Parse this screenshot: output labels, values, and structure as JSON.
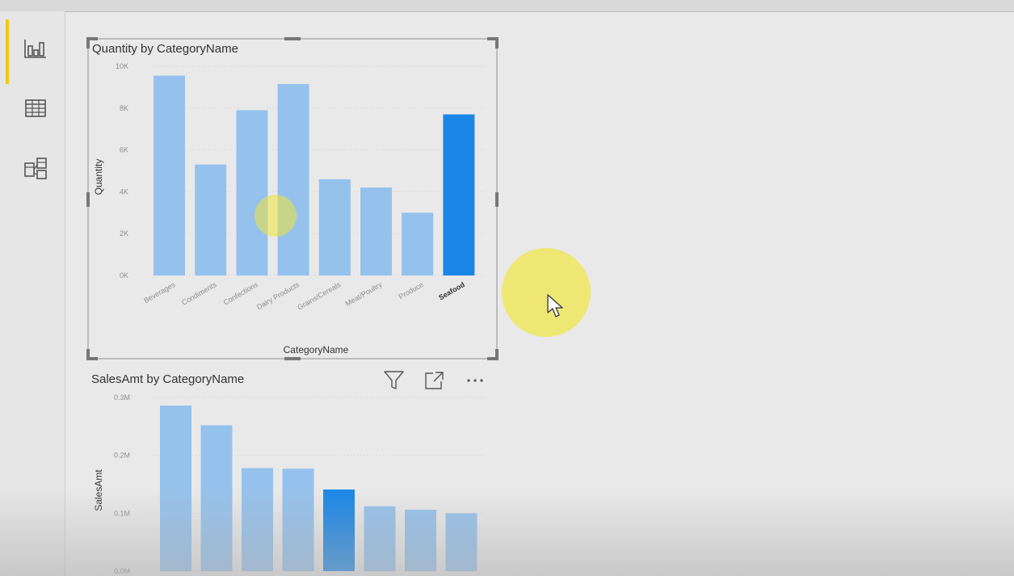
{
  "sidebar": {
    "items": [
      {
        "icon": "report-view-icon",
        "active": true
      },
      {
        "icon": "data-view-icon",
        "active": false
      },
      {
        "icon": "model-view-icon",
        "active": false
      }
    ],
    "active_color": "#f2c811"
  },
  "visual1": {
    "title": "Quantity by CategoryName",
    "selected": true,
    "chart_data": {
      "type": "bar",
      "title": "Quantity by CategoryName",
      "xlabel": "CategoryName",
      "ylabel": "Quantity",
      "ylim": [
        0,
        10000
      ],
      "y_ticks": [
        0,
        2000,
        4000,
        6000,
        8000,
        10000
      ],
      "y_tick_labels": [
        "0K",
        "2K",
        "4K",
        "6K",
        "8K",
        "10K"
      ],
      "categories": [
        "Beverages",
        "Condiments",
        "Confections",
        "Dairy Products",
        "Grains/Cereals",
        "Meat/Poultry",
        "Produce",
        "Seafood"
      ],
      "values": [
        9550,
        5300,
        7900,
        9150,
        4600,
        4200,
        3000,
        7700
      ],
      "highlighted_category": "Seafood",
      "grid": true,
      "bar_color": "#95c2ec",
      "highlight_color": "#1a86e6"
    }
  },
  "visual2": {
    "title": "SalesAmt by CategoryName",
    "header_icons": [
      "filter-icon",
      "focus-mode-icon",
      "more-options-icon"
    ],
    "chart_data": {
      "type": "bar",
      "title": "SalesAmt by CategoryName",
      "ylabel": "SalesAmt",
      "ylim": [
        0,
        300000
      ],
      "y_ticks": [
        0,
        100000,
        200000,
        300000
      ],
      "y_tick_labels": [
        "0.0M",
        "0.1M",
        "0.2M",
        "0.3M"
      ],
      "values": [
        286000,
        252000,
        178000,
        177000,
        141000,
        112000,
        106000,
        100000
      ],
      "highlighted_index": 4,
      "grid": true,
      "bar_color": "#95c2ec",
      "highlight_color": "#1a86e6"
    }
  },
  "pointer": {
    "highlight_color": "#f0e63c"
  }
}
